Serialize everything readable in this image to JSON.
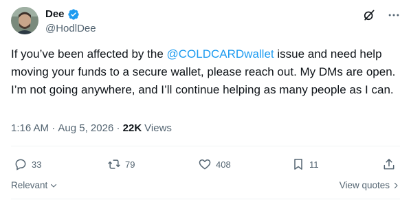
{
  "author": {
    "display_name": "Dee",
    "handle": "@HodlDee"
  },
  "tweet": {
    "text_before": "If you’ve been affected by the ",
    "mention": "@COLDCARDwallet",
    "text_after": "  issue and need help moving your funds to a secure wallet, please reach out. My DMs are open. I’m not going anywhere, and I’ll continue helping as many people as I can."
  },
  "meta": {
    "time": "1:16 AM",
    "separator": " · ",
    "date": "Aug 5, 2026",
    "separator2": " · ",
    "views_count": "22K",
    "views_label": "Views"
  },
  "actions": {
    "replies": "33",
    "reposts": "79",
    "likes": "408",
    "bookmarks": "11"
  },
  "footer": {
    "relevant_label": "Relevant",
    "view_quotes_label": "View quotes"
  },
  "icons": [
    "verified-badge-icon",
    "grok-icon",
    "more-icon",
    "reply-icon",
    "repost-icon",
    "like-icon",
    "bookmark-icon",
    "share-icon",
    "chevron-down-icon",
    "chevron-right-icon"
  ],
  "colors": {
    "accent": "#1d9bf0",
    "text": "#0f1419",
    "muted": "#536471"
  }
}
